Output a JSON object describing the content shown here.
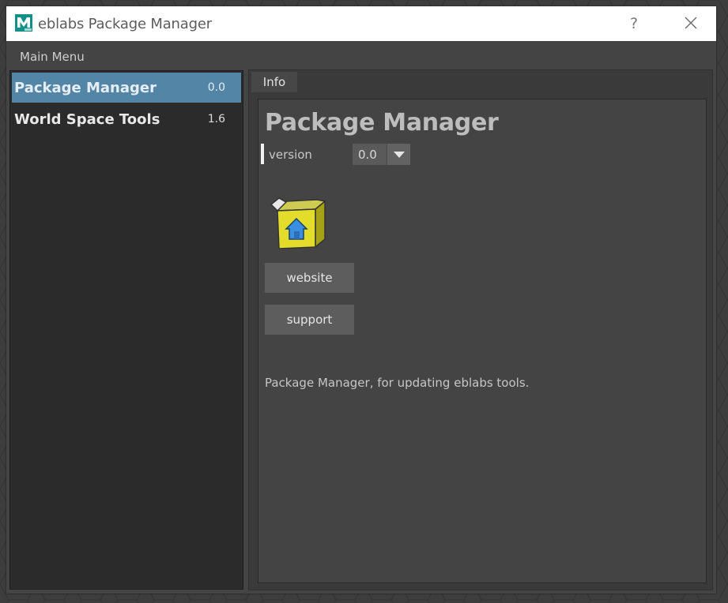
{
  "window": {
    "title": "eblabs Package Manager",
    "help_label": "?",
    "app_icon": "maya-icon",
    "close_icon": "close-icon"
  },
  "menubar": {
    "main_menu_label": "Main Menu"
  },
  "packages": [
    {
      "name": "Package Manager",
      "version": "0.0",
      "selected": true
    },
    {
      "name": "World Space Tools",
      "version": "1.6",
      "selected": false
    }
  ],
  "tabs": [
    {
      "label": "Info",
      "active": true
    }
  ],
  "detail": {
    "title": "Package Manager",
    "version_label": "version",
    "version_selected": "0.0",
    "package_icon": "package-box-icon",
    "website_label": "website",
    "support_label": "support",
    "description": "Package Manager, for updating eblabs tools."
  },
  "colors": {
    "selection": "#5285a6",
    "window_bg": "#444444",
    "list_bg": "#2b2b2b",
    "button_bg": "#5d5d5d",
    "titlebar_bg": "#ffffff"
  }
}
